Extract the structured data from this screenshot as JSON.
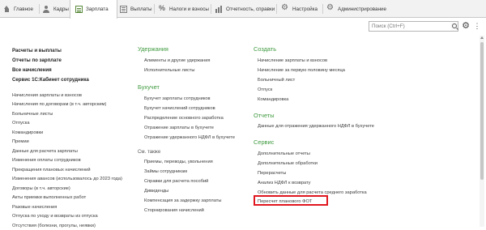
{
  "tabs": [
    {
      "label": "Главное",
      "icon": "house-icon"
    },
    {
      "label": "Кадры",
      "icon": "people-icon"
    },
    {
      "label": "Зарплата",
      "icon": "payroll-sheet-icon",
      "active": true
    },
    {
      "label": "Выплаты",
      "icon": "payment-list-icon"
    },
    {
      "label": "Налоги и взносы",
      "icon": "percent-icon"
    },
    {
      "label": "Отчетность, справки",
      "icon": "chart-icon"
    },
    {
      "label": "Настройка",
      "icon": "gear-icon"
    },
    {
      "label": "Администрирование",
      "icon": "admin-gear-icon"
    }
  ],
  "search": {
    "placeholder": "Поиск (Ctrl+F)"
  },
  "toolbar": {
    "settings_icon": "gear-icon",
    "more_icon": "more-icon",
    "settings_glyph": "⚙",
    "more_glyph": "⋮"
  },
  "left": {
    "bold_items": [
      "Расчеты и выплаты",
      "Отчеты по зарплате",
      "Все начисления",
      "Сервис 1С:Кабинет сотрудника"
    ],
    "items": [
      "Начисления зарплаты и взносов",
      "Начисления по договорам (в т.ч. авторским)",
      "Больничные листы",
      "Отпуска",
      "Командировки",
      "Премии",
      "Данные для расчета зарплаты",
      "Изменения оплаты сотрудников",
      "Прекращения плановых начислений",
      "Изменения авансов (использовалось до 2023 года)",
      "Договоры (в т.ч. авторские)",
      "Акты приемки выполненных работ",
      "Разовые начисления",
      "Отпуска по уходу и возвраты из отпуска",
      "Отсутствия (болезни, прогулы, неявки)"
    ]
  },
  "middle": {
    "heading1": "Удержания",
    "group1": [
      "Алименты и другие удержания",
      "Исполнительные листы"
    ],
    "heading2": "Бухучет",
    "group2": [
      "Бухучет зарплаты сотрудников",
      "Бухучет начислений сотрудников",
      "Распределение основного заработка",
      "Отражение зарплаты в бухучете",
      "Отражение удержанного НДФЛ в бухучете"
    ],
    "heading3": "См. также",
    "group3": [
      "Приемы, переводы, увольнения",
      "Займы сотрудникам",
      "Справки для расчета пособий",
      "Дивиденды",
      "Компенсация за задержку зарплаты",
      "Сторнирования начислений"
    ]
  },
  "right": {
    "heading1": "Создать",
    "group1": [
      "Начисление зарплаты и взносов",
      "Начисление за первую половину месяца",
      "Больничный лист",
      "Отпуск",
      "Командировка"
    ],
    "heading2": "Отчеты",
    "group2": [
      "Данные для отражения удержанного НДФЛ в бухучете"
    ],
    "heading3": "Сервис",
    "group3": [
      "Дополнительные отчеты",
      "Дополнительные обработки",
      "Перерасчеты",
      "Анализ НДФЛ к возврату",
      "Обновить данные для расчета среднего заработка",
      "Пересчет планового ФОТ"
    ]
  },
  "colors": {
    "heading": "#3f9a3f",
    "highlight": "#e0171f",
    "topbar": "#f2f2f2"
  }
}
